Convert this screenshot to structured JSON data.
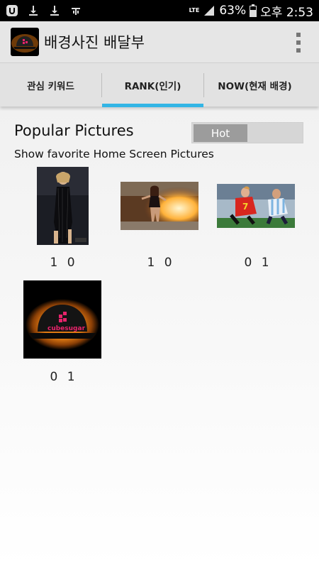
{
  "status_bar": {
    "network": "LTE",
    "battery": "63%",
    "time": "오후 2:53"
  },
  "app_bar": {
    "title": "배경사진 배달부",
    "logo_text": "cubesugar"
  },
  "tabs": [
    {
      "label": "관심 키워드",
      "selected": false
    },
    {
      "label": "RANK(인기)",
      "selected": true
    },
    {
      "label": "NOW(현재 배경)",
      "selected": false
    }
  ],
  "colors": {
    "tab_indicator": "#33b5e5",
    "cube_pink": "#e8236b"
  },
  "main": {
    "title": "Popular Pictures",
    "toggle_label": "Hot",
    "subtitle": "Show favorite Home Screen Pictures",
    "pictures": [
      {
        "count": "1 0",
        "icon": "performer-photo"
      },
      {
        "count": "1 0",
        "icon": "fashion-photo"
      },
      {
        "count": "0 1",
        "icon": "soccer-photo"
      },
      {
        "count": "0 1",
        "icon": "cubesugar-cap-photo",
        "logo_text": "cubesugar"
      }
    ]
  }
}
